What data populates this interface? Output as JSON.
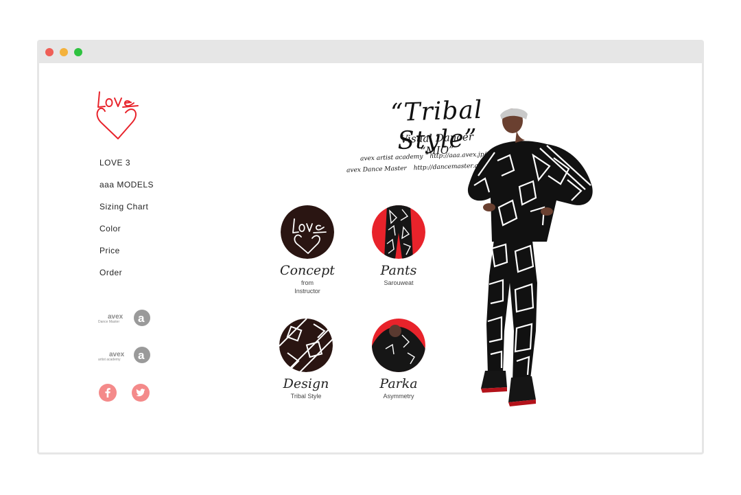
{
  "window": {
    "traffic_lights": [
      "#ef5f57",
      "#f4b23c",
      "#2fc240"
    ]
  },
  "brand": {
    "logo_text": "Love",
    "logo_color": "#e8232b"
  },
  "nav": {
    "items": [
      "LOVE 3",
      "aaa MODELS",
      "Sizing Chart",
      "Color",
      "Price",
      "Order"
    ]
  },
  "partners": {
    "dance_master": {
      "mark": "avex",
      "caption": "Dance Master"
    },
    "artist_academy": {
      "mark": "avex",
      "caption": "artist academy"
    }
  },
  "social": {
    "facebook_icon": "facebook-icon",
    "twitter_icon": "twitter-icon",
    "color": "#f48a8a"
  },
  "hero": {
    "title": "“Tribal Style”",
    "subtitle": "Visual Dancer “MIO”",
    "credits": [
      {
        "name": "avex artist academy",
        "url": "http://aaa.avex.jp/wdpr/"
      },
      {
        "name": "avex Dance Master",
        "url": "http://dancemaster.avex"
      }
    ]
  },
  "tiles": [
    {
      "title": "Concept",
      "subtitle": "from\nInstructor",
      "subtitle_lines": [
        "from",
        "Instructor"
      ]
    },
    {
      "title": "Pants",
      "subtitle": "Sarouweat"
    },
    {
      "title": "Design",
      "subtitle": "Tribal Style"
    },
    {
      "title": "Parka",
      "subtitle": "Asymmetry"
    }
  ],
  "colors": {
    "accent_red": "#e8232b",
    "tile_dark": "#2a1512",
    "text": "#222222"
  }
}
